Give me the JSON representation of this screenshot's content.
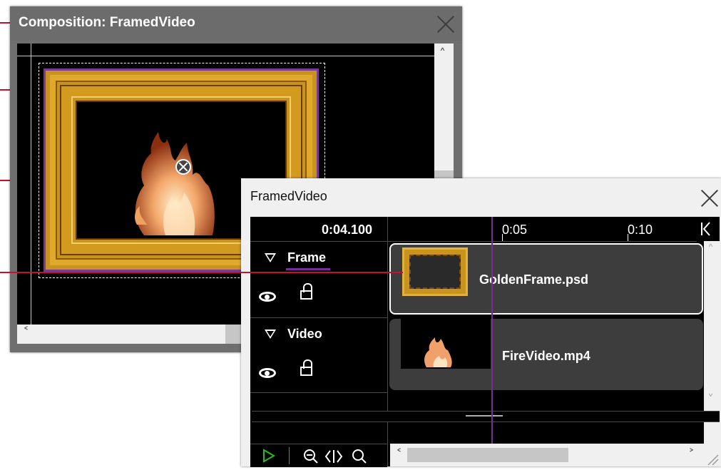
{
  "comp_window": {
    "title": "Composition: FramedVideo"
  },
  "timeline_window": {
    "title": "FramedVideo",
    "current_time": "0:04.100",
    "ruler_marks": [
      "0:05",
      "0:10"
    ],
    "layers": [
      {
        "name": "Frame",
        "clip": "GoldenFrame.psd",
        "selected": true
      },
      {
        "name": "Video",
        "clip": "FireVideo.mp4",
        "selected": false
      }
    ]
  },
  "icons": {
    "close": "close-icon",
    "expand": "triangle-down-icon",
    "visibility": "eye-icon",
    "lock": "lock-icon",
    "play": "play-icon",
    "zoom_out": "zoom-out-icon",
    "fit": "fit-icon",
    "zoom": "zoom-icon",
    "go_start": "go-to-start-icon"
  },
  "colors": {
    "callout": "#c8102e",
    "playhead": "#7a2a9a",
    "selection_underline": "#7a2a9a",
    "play": "#22c01e"
  }
}
